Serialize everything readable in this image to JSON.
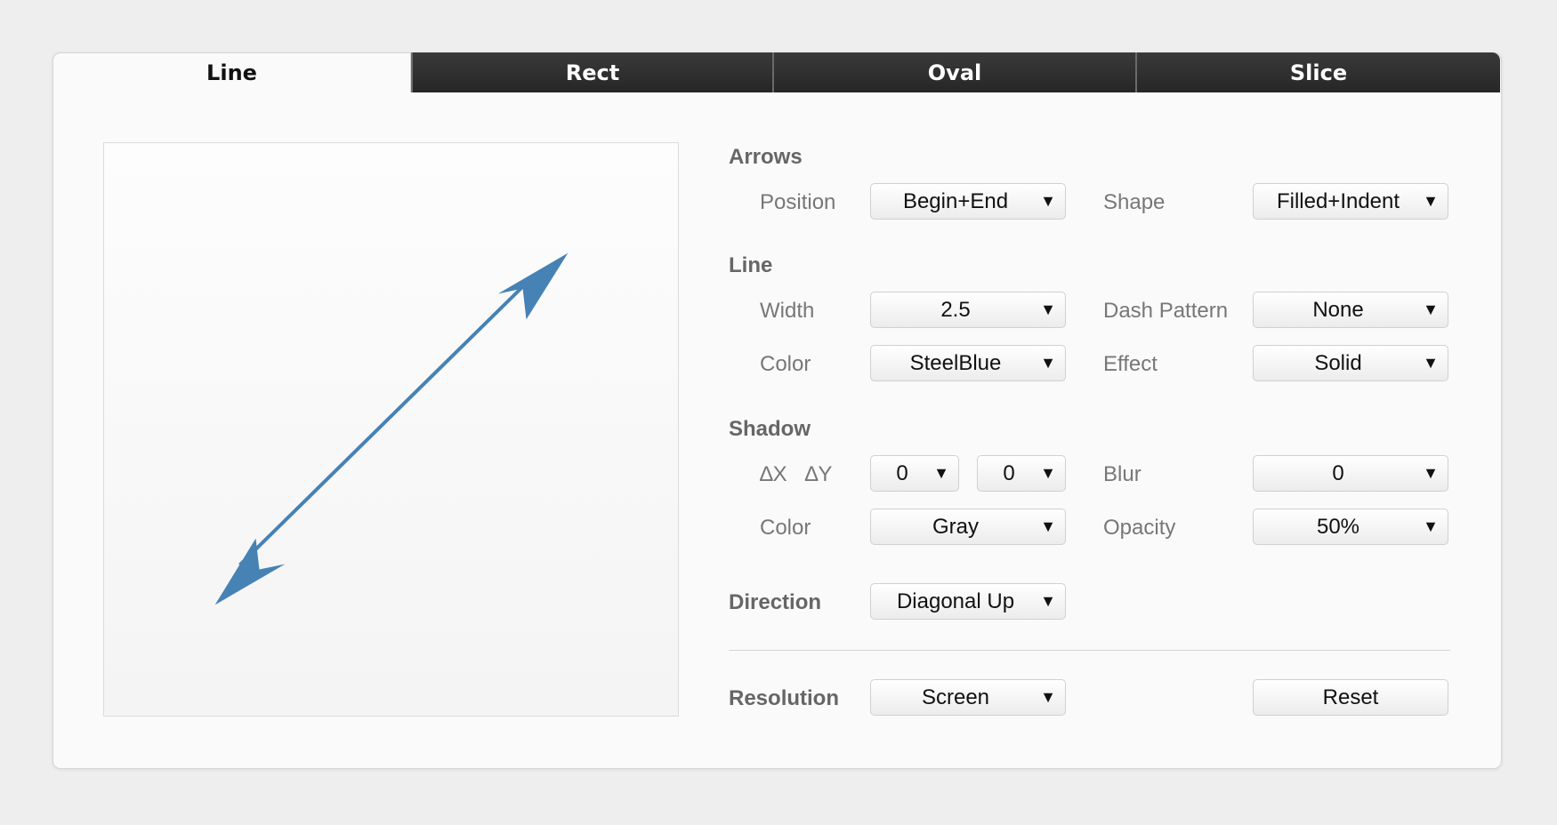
{
  "tabs": [
    {
      "label": "Line",
      "active": true
    },
    {
      "label": "Rect",
      "active": false
    },
    {
      "label": "Oval",
      "active": false
    },
    {
      "label": "Slice",
      "active": false
    }
  ],
  "preview": {
    "line_color": "#4682B4",
    "arrow_positions": "Begin+End",
    "direction": "Diagonal Up"
  },
  "arrows": {
    "section": "Arrows",
    "position_label": "Position",
    "position_value": "Begin+End",
    "shape_label": "Shape",
    "shape_value": "Filled+Indent"
  },
  "line": {
    "section": "Line",
    "width_label": "Width",
    "width_value": "2.5",
    "dash_label": "Dash Pattern",
    "dash_value": "None",
    "color_label": "Color",
    "color_value": "SteelBlue",
    "effect_label": "Effect",
    "effect_value": "Solid"
  },
  "shadow": {
    "section": "Shadow",
    "dxdy_label": "∆X   ∆Y",
    "dx_value": "0",
    "dy_value": "0",
    "blur_label": "Blur",
    "blur_value": "0",
    "color_label": "Color",
    "color_value": "Gray",
    "opacity_label": "Opacity",
    "opacity_value": "50%"
  },
  "direction": {
    "label": "Direction",
    "value": "Diagonal Up"
  },
  "resolution": {
    "label": "Resolution",
    "value": "Screen"
  },
  "reset_label": "Reset",
  "dropdown_glyph": "▼"
}
